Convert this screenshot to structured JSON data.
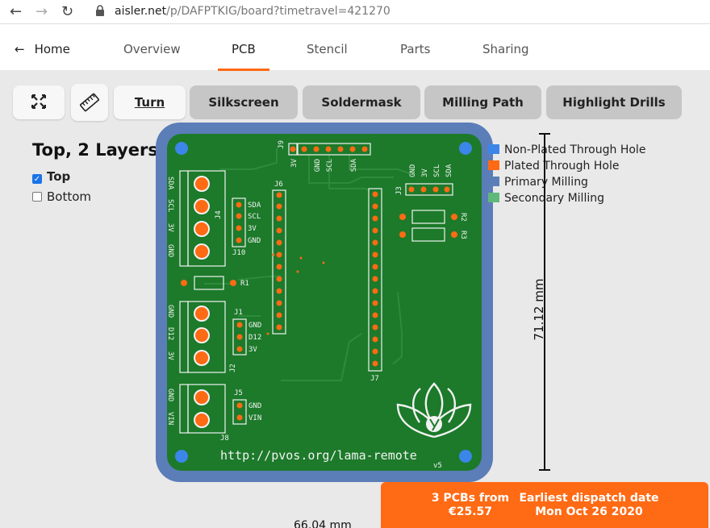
{
  "browser": {
    "url_domain": "aisler.net",
    "url_path": "/p/DAFPTKIG/board?timetravel=421270"
  },
  "nav": {
    "home": "Home",
    "tabs": [
      "Overview",
      "PCB",
      "Stencil",
      "Parts",
      "Sharing"
    ],
    "active_tab": "PCB"
  },
  "toolbar": {
    "turn": "Turn",
    "silkscreen": "Silkscreen",
    "soldermask": "Soldermask",
    "milling_path": "Milling Path",
    "highlight_drills": "Highlight Drills"
  },
  "layers": {
    "title": "Top, 2 Layers",
    "top": "Top",
    "top_checked": true,
    "bottom": "Bottom",
    "bottom_checked": false
  },
  "legend": [
    {
      "label": "Non-Plated Through Hole",
      "color": "#3b86e8"
    },
    {
      "label": "Plated Through Hole",
      "color": "#ff6a14"
    },
    {
      "label": "Primary Milling",
      "color": "#5b7db8"
    },
    {
      "label": "Secondary Milling",
      "color": "#5fb97a"
    }
  ],
  "dimensions": {
    "height": "71.12 mm",
    "width": "66.04 mm"
  },
  "pcb_silkscreen": {
    "url_text": "http://pvos.org/lama-remote",
    "version": "v5",
    "j9": "J9",
    "j9_pins": [
      "3V",
      "GND",
      "SCL",
      "SDA"
    ],
    "j3": "J3",
    "j3_pins": [
      "GND",
      "3V",
      "SCL",
      "SDA"
    ],
    "j6": "J6",
    "j7": "J7",
    "j4": "J4",
    "j4_pins": [
      "SDA",
      "SCL",
      "3V",
      "GND"
    ],
    "j10": "J10",
    "j10_pins": [
      "SDA",
      "SCL",
      "3V",
      "GND"
    ],
    "r1": "R1",
    "r2": "R2",
    "r3": "R3",
    "j1": "J1",
    "j1_pins": [
      "GND",
      "D12",
      "3V"
    ],
    "j2": "J2",
    "j2_pins": [
      "GND",
      "D12",
      "3V"
    ],
    "j5": "J5",
    "j5_pins": [
      "GND",
      "VIN"
    ],
    "j8": "J8",
    "j8_pins": [
      "GND",
      "VIN"
    ]
  },
  "order": {
    "pcbs": "3 PCBs from",
    "price": "€25.57",
    "dispatch_label": "Earliest dispatch date",
    "dispatch_date": "Mon Oct 26 2020"
  }
}
